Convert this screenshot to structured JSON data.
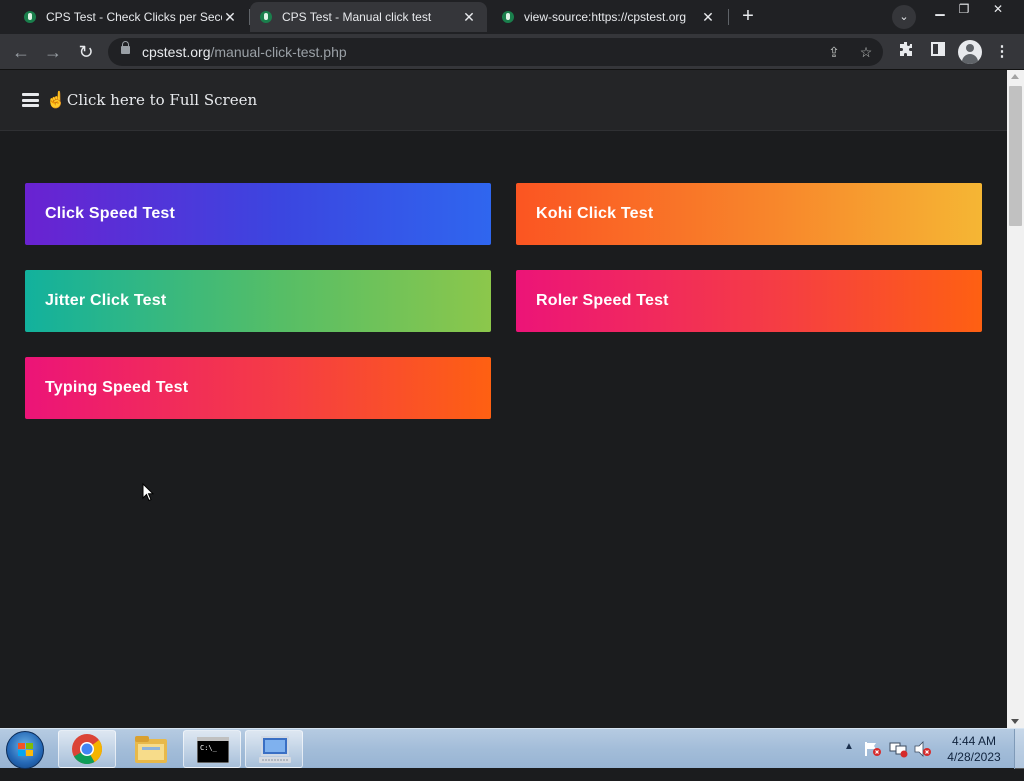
{
  "browser": {
    "tabs": [
      {
        "title": "CPS Test - Check Clicks per Secon",
        "active": false
      },
      {
        "title": "CPS Test - Manual click test",
        "active": true
      },
      {
        "title": "view-source:https://cpstest.org",
        "active": false
      }
    ],
    "url_domain": "cpstest.org",
    "url_path": "/manual-click-test.php",
    "icons": [
      "back-icon",
      "forward-icon",
      "reload-icon",
      "lock-icon",
      "share-icon",
      "star-icon",
      "extensions-icon",
      "side-panel-icon",
      "profile-icon",
      "menu-icon"
    ]
  },
  "page": {
    "fullscreen_label": "Click here to Full Screen",
    "tiles": [
      {
        "label": "Click Speed Test",
        "gradient": [
          "#6a22d1",
          "#2f66ef"
        ]
      },
      {
        "label": "Kohi Click Test",
        "gradient": [
          "#fb5522",
          "#f5b634"
        ]
      },
      {
        "label": "Jitter Click Test",
        "gradient": [
          "#12b19d",
          "#8cc74b"
        ]
      },
      {
        "label": "Roler Speed Test",
        "gradient": [
          "#ec1478",
          "#fe6012"
        ]
      },
      {
        "label": "Typing Speed Test",
        "gradient": [
          "#ec1478",
          "#fe6012"
        ]
      }
    ]
  },
  "taskbar": {
    "apps": [
      "chrome-icon",
      "file-explorer-icon",
      "command-prompt-icon",
      "remote-desktop-icon"
    ],
    "time": "4:44 AM",
    "date": "4/28/2023"
  },
  "colors": {
    "page_bg": "#1b1c1e",
    "header_bg": "#242527",
    "tabstrip_bg": "#202124",
    "toolbar_bg": "#35363a"
  }
}
